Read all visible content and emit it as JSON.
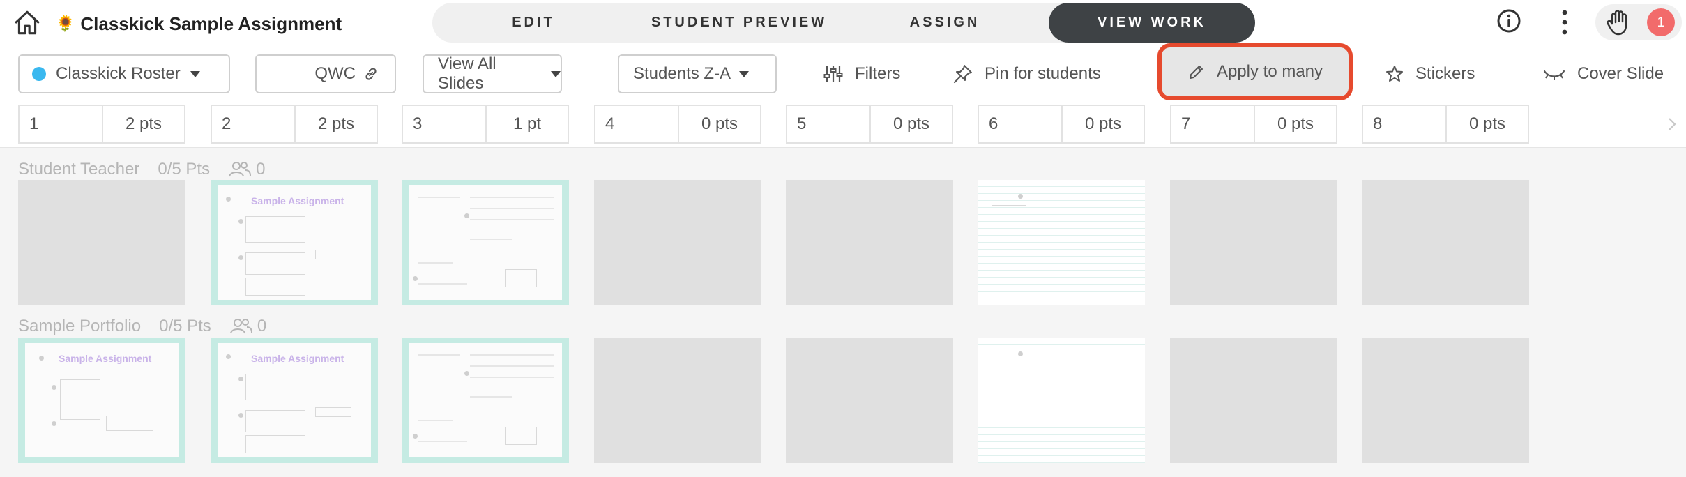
{
  "header": {
    "title": "Classkick Sample Assignment",
    "title_emoji": "🌻",
    "tabs": [
      "EDIT",
      "STUDENT PREVIEW",
      "ASSIGN",
      "VIEW WORK"
    ],
    "active_tab": "VIEW WORK",
    "notification_count": "1"
  },
  "toolbar": {
    "roster_label": "Classkick Roster",
    "roster_color": "#3ab8ef",
    "class_code": "QWC",
    "slides_filter": "View All Slides",
    "sort_label": "Students Z-A",
    "filters_label": "Filters",
    "pin_label": "Pin for students",
    "apply_label": "Apply to many",
    "stickers_label": "Stickers",
    "cover_label": "Cover Slide",
    "highlight_color": "#e64a2e"
  },
  "slides": [
    {
      "num": "1",
      "pts": "2 pts"
    },
    {
      "num": "2",
      "pts": "2 pts"
    },
    {
      "num": "3",
      "pts": "1 pt"
    },
    {
      "num": "4",
      "pts": "0 pts"
    },
    {
      "num": "5",
      "pts": "0 pts"
    },
    {
      "num": "6",
      "pts": "0 pts"
    },
    {
      "num": "7",
      "pts": "0 pts"
    },
    {
      "num": "8",
      "pts": "0 pts"
    }
  ],
  "students": [
    {
      "name": "Student Teacher",
      "score": "0/5 Pts",
      "group": "0"
    },
    {
      "name": "Sample Portfolio",
      "score": "0/5 Pts",
      "group": "0"
    }
  ],
  "thumbnail_text": "Sample Assignment",
  "icons": [
    "home-icon",
    "info-icon",
    "more-vertical-icon",
    "raised-hand-icon",
    "link-icon",
    "filter-sliders-icon",
    "pin-icon",
    "pencil-icon",
    "star-icon",
    "eye-closed-icon",
    "chevron-right-icon",
    "group-icon"
  ]
}
